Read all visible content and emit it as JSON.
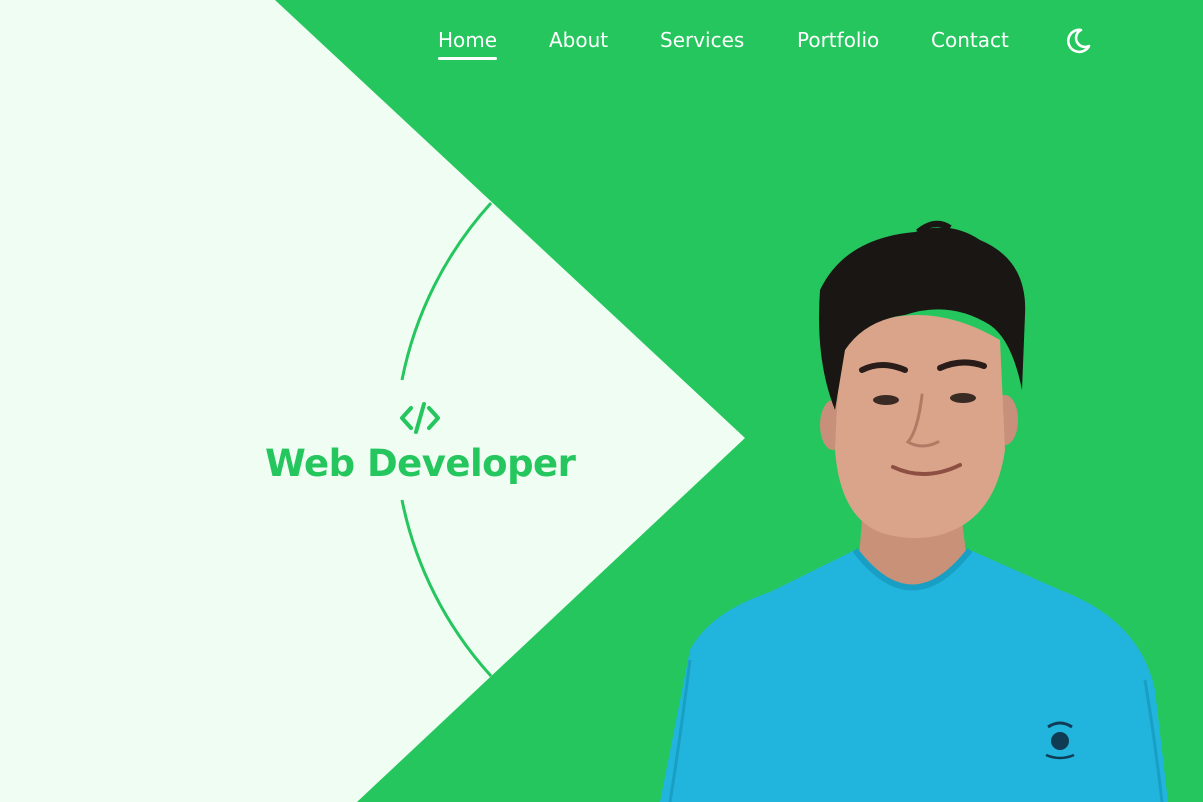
{
  "nav": {
    "items": [
      {
        "label": "Home",
        "active": true
      },
      {
        "label": "About",
        "active": false
      },
      {
        "label": "Services",
        "active": false
      },
      {
        "label": "Portfolio",
        "active": false
      },
      {
        "label": "Contact",
        "active": false
      }
    ],
    "theme_icon": "moon-icon"
  },
  "hero": {
    "icon": "code-icon",
    "title": "Web Developer"
  },
  "colors": {
    "accent": "#25c65e",
    "panel": "#effdf3",
    "text_light": "#ffffff",
    "shirt": "#21b5dd",
    "hair": "#1a1614",
    "skin": "#d9a48a"
  }
}
